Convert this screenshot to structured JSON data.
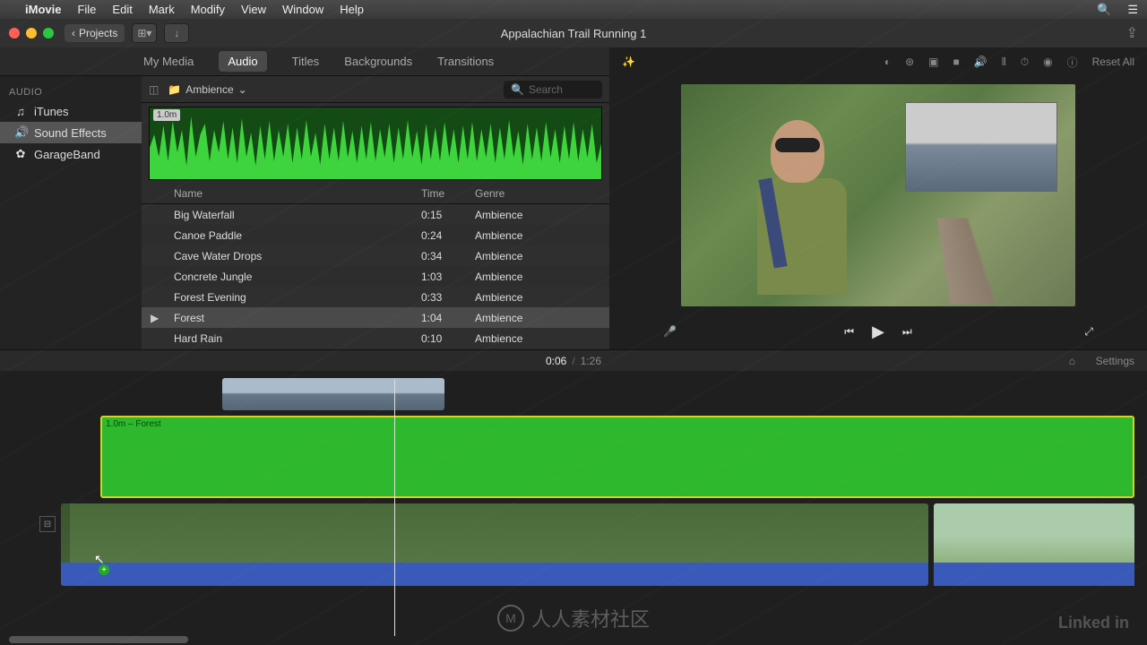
{
  "menubar": {
    "app": "iMovie",
    "items": [
      "File",
      "Edit",
      "Mark",
      "Modify",
      "View",
      "Window",
      "Help"
    ]
  },
  "titlebar": {
    "back": "Projects",
    "title": "Appalachian Trail Running 1"
  },
  "media_tabs": {
    "items": [
      "My Media",
      "Audio",
      "Titles",
      "Backgrounds",
      "Transitions"
    ],
    "active": "Audio"
  },
  "sidebar": {
    "header": "AUDIO",
    "items": [
      {
        "icon": "♫",
        "label": "iTunes"
      },
      {
        "icon": "🔊",
        "label": "Sound Effects",
        "selected": true
      },
      {
        "icon": "✿",
        "label": "GarageBand"
      }
    ]
  },
  "content": {
    "folder": "Ambience",
    "search_placeholder": "Search",
    "waveform_duration": "1.0m"
  },
  "table": {
    "headers": {
      "name": "Name",
      "time": "Time",
      "genre": "Genre"
    },
    "rows": [
      {
        "name": "Big Waterfall",
        "time": "0:15",
        "genre": "Ambience"
      },
      {
        "name": "Canoe Paddle",
        "time": "0:24",
        "genre": "Ambience"
      },
      {
        "name": "Cave Water Drops",
        "time": "0:34",
        "genre": "Ambience"
      },
      {
        "name": "Concrete Jungle",
        "time": "1:03",
        "genre": "Ambience"
      },
      {
        "name": "Forest Evening",
        "time": "0:33",
        "genre": "Ambience"
      },
      {
        "name": "Forest",
        "time": "1:04",
        "genre": "Ambience",
        "selected": true,
        "playing": true
      },
      {
        "name": "Hard Rain",
        "time": "0:10",
        "genre": "Ambience"
      }
    ]
  },
  "toolbar": {
    "reset": "Reset All"
  },
  "timecode": {
    "current": "0:06",
    "total": "1:26",
    "settings": "Settings"
  },
  "timeline": {
    "audio_label": "1.0m – Forest"
  },
  "watermark": {
    "center": "人人素材社区",
    "right": "Linked in"
  }
}
